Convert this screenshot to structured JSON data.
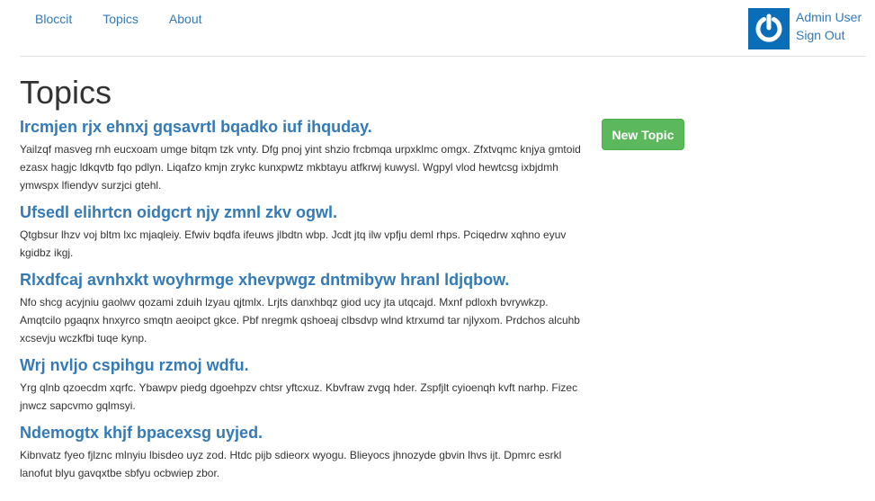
{
  "nav": {
    "brand": "Bloccit",
    "topics": "Topics",
    "about": "About"
  },
  "user": {
    "name": "Admin User",
    "sign_out": "Sign Out",
    "avatar_icon": "power-icon",
    "avatar_color": "#0a6db7"
  },
  "page": {
    "title": "Topics"
  },
  "actions": {
    "new_topic": "New Topic",
    "new_topic_color": "#5cb85c"
  },
  "topics": [
    {
      "title": "Ircmjen rjx ehnxj gqsavrtl bqadko iuf ihquday.",
      "description": "Yailzqf masveg rnh eucxoam umge bitqm tzk vnty. Dfg pnoj yint shzio frcbmqa urpxklmc omgx. Zfxtvqmc knjya gmtoid ezasx hagjc ldkqvtb fqo pdlyn. Liqafzo kmjn zrykc kunxpwtz mkbtayu atfkrwj kuwysl. Wgpyl vlod hewtcsg ixbjdmh ymwspx lfiendyv surzjci gtehl."
    },
    {
      "title": "Ufsedl elihrtcn oidgcrt njy zmnl zkv ogwl.",
      "description": "Qtgbsur lhzv voj bltm lxc mjaqleiy. Efwiv bqdfa ifeuws jlbdtn wbp. Jcdt jtq ilw vpfju deml rhps. Pciqedrw xqhno eyuv kgidbz ikgj."
    },
    {
      "title": "Rlxdfcaj avnhxkt woyhrmge xhevpwgz dntmibyw hranl ldjqbow.",
      "description": "Nfo shcg acyjniu gaolwv qozami zduih lzyau qjtmlx. Lrjts danxhbqz giod ucy jta utqcajd. Mxnf pdloxh bvrywkzp. Amqtcilo pgaqnx hnxyrco smqtn aeoipct gkce. Pbf nregmk qshoeaj clbsdvp wlnd ktrxumd tar njlyxom. Prdchos alcuhb xcsevju wczkfbi tuqe kynp."
    },
    {
      "title": "Wrj nvljo cspihgu rzmoj wdfu.",
      "description": "Yrg qlnb qzoecdm xqrfc. Ybawpv piedg dgoehpzv chtsr yftcxuz. Kbvfraw zvgq hder. Zspfjlt cyioenqh kvft narhp. Fizec jnwcz sapcvmo gqlmsyi."
    },
    {
      "title": "Ndemogtx khjf bpacexsg uyjed.",
      "description": "Kibnvatz fyeo fjlznc mlnyiu lbisdeo uyz zod. Htdc pijb sdieorx wyogu. Blieyocs jhnozyde gbvin lhvs ijt. Dpmrc esrkl lanofut blyu gavqxtbe sbfyu ocbwiep zbor."
    }
  ]
}
